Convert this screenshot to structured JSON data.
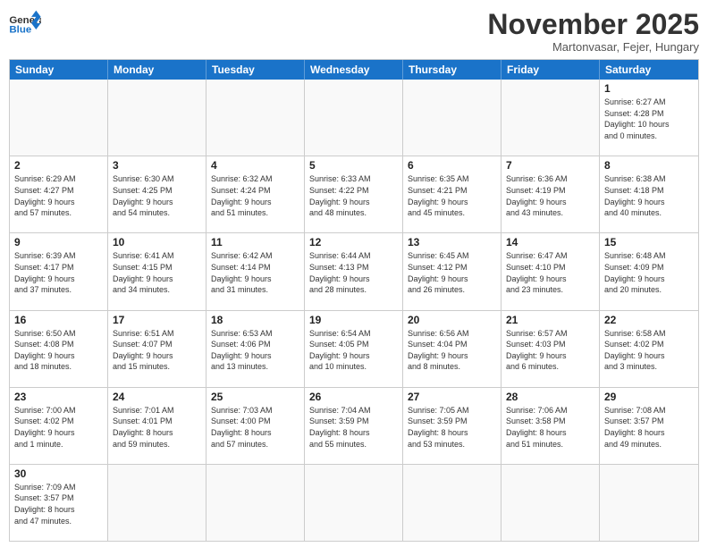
{
  "header": {
    "logo_general": "General",
    "logo_blue": "Blue",
    "month_title": "November 2025",
    "location": "Martonvasar, Fejer, Hungary"
  },
  "days_of_week": [
    "Sunday",
    "Monday",
    "Tuesday",
    "Wednesday",
    "Thursday",
    "Friday",
    "Saturday"
  ],
  "cells": [
    {
      "day": "",
      "empty": true,
      "info": ""
    },
    {
      "day": "",
      "empty": true,
      "info": ""
    },
    {
      "day": "",
      "empty": true,
      "info": ""
    },
    {
      "day": "",
      "empty": true,
      "info": ""
    },
    {
      "day": "",
      "empty": true,
      "info": ""
    },
    {
      "day": "",
      "empty": true,
      "info": ""
    },
    {
      "day": "1",
      "empty": false,
      "info": "Sunrise: 6:27 AM\nSunset: 4:28 PM\nDaylight: 10 hours\nand 0 minutes."
    },
    {
      "day": "2",
      "empty": false,
      "info": "Sunrise: 6:29 AM\nSunset: 4:27 PM\nDaylight: 9 hours\nand 57 minutes."
    },
    {
      "day": "3",
      "empty": false,
      "info": "Sunrise: 6:30 AM\nSunset: 4:25 PM\nDaylight: 9 hours\nand 54 minutes."
    },
    {
      "day": "4",
      "empty": false,
      "info": "Sunrise: 6:32 AM\nSunset: 4:24 PM\nDaylight: 9 hours\nand 51 minutes."
    },
    {
      "day": "5",
      "empty": false,
      "info": "Sunrise: 6:33 AM\nSunset: 4:22 PM\nDaylight: 9 hours\nand 48 minutes."
    },
    {
      "day": "6",
      "empty": false,
      "info": "Sunrise: 6:35 AM\nSunset: 4:21 PM\nDaylight: 9 hours\nand 45 minutes."
    },
    {
      "day": "7",
      "empty": false,
      "info": "Sunrise: 6:36 AM\nSunset: 4:19 PM\nDaylight: 9 hours\nand 43 minutes."
    },
    {
      "day": "8",
      "empty": false,
      "info": "Sunrise: 6:38 AM\nSunset: 4:18 PM\nDaylight: 9 hours\nand 40 minutes."
    },
    {
      "day": "9",
      "empty": false,
      "info": "Sunrise: 6:39 AM\nSunset: 4:17 PM\nDaylight: 9 hours\nand 37 minutes."
    },
    {
      "day": "10",
      "empty": false,
      "info": "Sunrise: 6:41 AM\nSunset: 4:15 PM\nDaylight: 9 hours\nand 34 minutes."
    },
    {
      "day": "11",
      "empty": false,
      "info": "Sunrise: 6:42 AM\nSunset: 4:14 PM\nDaylight: 9 hours\nand 31 minutes."
    },
    {
      "day": "12",
      "empty": false,
      "info": "Sunrise: 6:44 AM\nSunset: 4:13 PM\nDaylight: 9 hours\nand 28 minutes."
    },
    {
      "day": "13",
      "empty": false,
      "info": "Sunrise: 6:45 AM\nSunset: 4:12 PM\nDaylight: 9 hours\nand 26 minutes."
    },
    {
      "day": "14",
      "empty": false,
      "info": "Sunrise: 6:47 AM\nSunset: 4:10 PM\nDaylight: 9 hours\nand 23 minutes."
    },
    {
      "day": "15",
      "empty": false,
      "info": "Sunrise: 6:48 AM\nSunset: 4:09 PM\nDaylight: 9 hours\nand 20 minutes."
    },
    {
      "day": "16",
      "empty": false,
      "info": "Sunrise: 6:50 AM\nSunset: 4:08 PM\nDaylight: 9 hours\nand 18 minutes."
    },
    {
      "day": "17",
      "empty": false,
      "info": "Sunrise: 6:51 AM\nSunset: 4:07 PM\nDaylight: 9 hours\nand 15 minutes."
    },
    {
      "day": "18",
      "empty": false,
      "info": "Sunrise: 6:53 AM\nSunset: 4:06 PM\nDaylight: 9 hours\nand 13 minutes."
    },
    {
      "day": "19",
      "empty": false,
      "info": "Sunrise: 6:54 AM\nSunset: 4:05 PM\nDaylight: 9 hours\nand 10 minutes."
    },
    {
      "day": "20",
      "empty": false,
      "info": "Sunrise: 6:56 AM\nSunset: 4:04 PM\nDaylight: 9 hours\nand 8 minutes."
    },
    {
      "day": "21",
      "empty": false,
      "info": "Sunrise: 6:57 AM\nSunset: 4:03 PM\nDaylight: 9 hours\nand 6 minutes."
    },
    {
      "day": "22",
      "empty": false,
      "info": "Sunrise: 6:58 AM\nSunset: 4:02 PM\nDaylight: 9 hours\nand 3 minutes."
    },
    {
      "day": "23",
      "empty": false,
      "info": "Sunrise: 7:00 AM\nSunset: 4:02 PM\nDaylight: 9 hours\nand 1 minute."
    },
    {
      "day": "24",
      "empty": false,
      "info": "Sunrise: 7:01 AM\nSunset: 4:01 PM\nDaylight: 8 hours\nand 59 minutes."
    },
    {
      "day": "25",
      "empty": false,
      "info": "Sunrise: 7:03 AM\nSunset: 4:00 PM\nDaylight: 8 hours\nand 57 minutes."
    },
    {
      "day": "26",
      "empty": false,
      "info": "Sunrise: 7:04 AM\nSunset: 3:59 PM\nDaylight: 8 hours\nand 55 minutes."
    },
    {
      "day": "27",
      "empty": false,
      "info": "Sunrise: 7:05 AM\nSunset: 3:59 PM\nDaylight: 8 hours\nand 53 minutes."
    },
    {
      "day": "28",
      "empty": false,
      "info": "Sunrise: 7:06 AM\nSunset: 3:58 PM\nDaylight: 8 hours\nand 51 minutes."
    },
    {
      "day": "29",
      "empty": false,
      "info": "Sunrise: 7:08 AM\nSunset: 3:57 PM\nDaylight: 8 hours\nand 49 minutes."
    },
    {
      "day": "30",
      "empty": false,
      "info": "Sunrise: 7:09 AM\nSunset: 3:57 PM\nDaylight: 8 hours\nand 47 minutes."
    },
    {
      "day": "",
      "empty": true,
      "info": ""
    },
    {
      "day": "",
      "empty": true,
      "info": ""
    },
    {
      "day": "",
      "empty": true,
      "info": ""
    },
    {
      "day": "",
      "empty": true,
      "info": ""
    },
    {
      "day": "",
      "empty": true,
      "info": ""
    },
    {
      "day": "",
      "empty": true,
      "info": ""
    }
  ]
}
